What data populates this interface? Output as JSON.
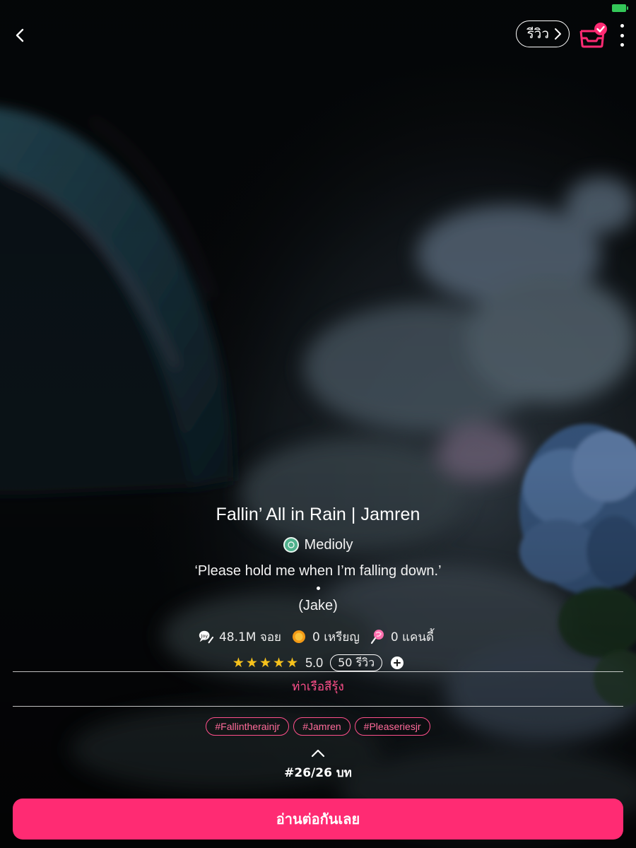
{
  "header": {
    "review_label": "รีวิว"
  },
  "story": {
    "title": "Fallin’ All in Rain | Jamren",
    "author": "Medioly",
    "tagline": "‘Please hold me when I’m falling down.’",
    "tagline_attribution": "(Jake)"
  },
  "stats": {
    "views": "48.1M จอย",
    "coins": "0 เหรียญ",
    "candies": "0 แคนดี้"
  },
  "rating": {
    "score": "5.0",
    "stars_filled": 5,
    "review_count": "50 รีวิว"
  },
  "category": "ท่าเรือสีรุ้ง",
  "tags": [
    "#Fallintherainjr",
    "#Jamren",
    "#Pleaseriesjr"
  ],
  "chapter": "#26/26 บท",
  "cta_label": "อ่านต่อกันเลย",
  "colors": {
    "accent": "#ff2b73",
    "star": "#f6c21c",
    "battery": "#34c759"
  },
  "icons": {
    "back": "chevron-left-icon",
    "review_arrow": "chevron-right-icon",
    "library": "library-check-icon",
    "more": "more-vertical-icon",
    "views": "joy-icon",
    "coins": "coin-icon",
    "candies": "candy-icon",
    "add": "plus-icon",
    "expand": "chevron-up-icon"
  }
}
